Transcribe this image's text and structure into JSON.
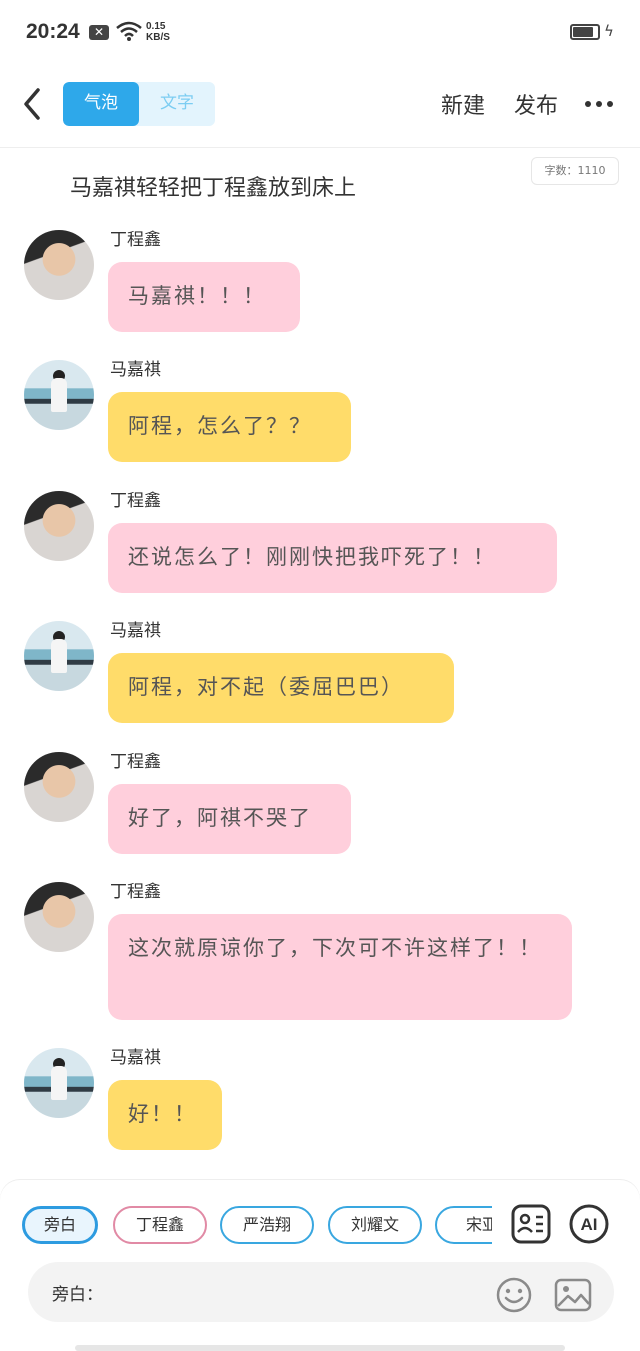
{
  "status_bar": {
    "time": "20:24",
    "notif_icon": "x-box-icon",
    "speed_value": "0.15",
    "speed_unit": "KB/S",
    "battery_level": 0.85
  },
  "header": {
    "back_icon": "chevron-left-icon",
    "tabs": [
      {
        "label": "气泡",
        "active": true
      },
      {
        "label": "文字",
        "active": false
      }
    ],
    "new_label": "新建",
    "publish_label": "发布",
    "more_icon": "more-dots-icon"
  },
  "content": {
    "narration": "马嘉祺轻轻把丁程鑫放到床上",
    "word_count": "字数：1110",
    "messages": [
      {
        "name": "丁程鑫",
        "text": "马嘉祺！！！",
        "color": "pink"
      },
      {
        "name": "马嘉祺",
        "text": "阿程，怎么了？？",
        "color": "yellow"
      },
      {
        "name": "丁程鑫",
        "text": "还说怎么了！刚刚快把我吓死了！！",
        "color": "pink"
      },
      {
        "name": "马嘉祺",
        "text": "阿程，对不起（委屈巴巴）",
        "color": "yellow"
      },
      {
        "name": "丁程鑫",
        "text": "好了，阿祺不哭了",
        "color": "pink"
      },
      {
        "name": "丁程鑫",
        "text": "这次就原谅你了，下次可不许这样了！！",
        "color": "pink"
      },
      {
        "name": "马嘉祺",
        "text": "好！！",
        "color": "yellow"
      }
    ]
  },
  "composer": {
    "roles": [
      "旁白",
      "丁程鑫",
      "严浩翔",
      "刘耀文",
      "宋亚"
    ],
    "role_card_icon": "role-card-icon",
    "ai_label": "AI",
    "input_label": "旁白：",
    "input_value": "",
    "emoji_icon": "smiley-icon",
    "image_icon": "image-icon"
  },
  "colors": {
    "accent": "#2ea8ea",
    "pink_bubble": "#ffcfdc",
    "yellow_bubble": "#ffdc6a"
  }
}
